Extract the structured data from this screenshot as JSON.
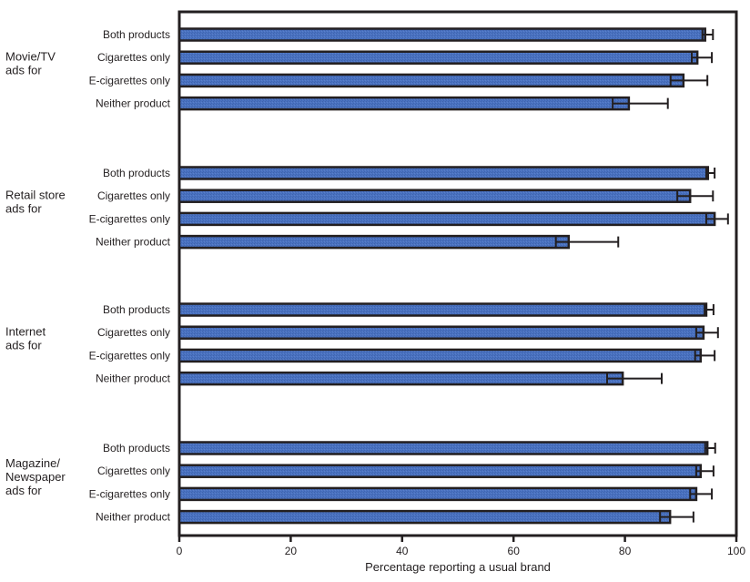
{
  "chart_data": {
    "type": "bar",
    "orientation": "horizontal",
    "title": "",
    "xlabel": "Percentage reporting a usual brand",
    "ylabel": "",
    "xlim": [
      0,
      100
    ],
    "xticks": [
      0,
      20,
      40,
      60,
      80,
      100
    ],
    "grid": false,
    "legend": null,
    "error_bars": "95% confidence interval",
    "colors": {
      "bar_fill": "#4a72c0",
      "bar_edge": "#231f20",
      "frame": "#231f20"
    },
    "categories": [
      "Both products",
      "Cigarettes only",
      "E-cigarettes only",
      "Neither product"
    ],
    "groups": [
      {
        "label_lines": [
          "Movie/TV",
          "ads for"
        ],
        "bars": [
          {
            "category": "Both products",
            "value": 94.4,
            "ci_low": 93.9,
            "ci_high": 95.8
          },
          {
            "category": "Cigarettes only",
            "value": 93.0,
            "ci_low": 92.0,
            "ci_high": 95.6
          },
          {
            "category": "E-cigarettes only",
            "value": 90.5,
            "ci_low": 88.2,
            "ci_high": 94.8
          },
          {
            "category": "Neither product",
            "value": 80.7,
            "ci_low": 77.8,
            "ci_high": 87.7
          }
        ]
      },
      {
        "label_lines": [
          "Retail store",
          "ads for"
        ],
        "bars": [
          {
            "category": "Both products",
            "value": 94.9,
            "ci_low": 94.6,
            "ci_high": 96.1
          },
          {
            "category": "Cigarettes only",
            "value": 91.7,
            "ci_low": 89.4,
            "ci_high": 95.8
          },
          {
            "category": "E-cigarettes only",
            "value": 96.1,
            "ci_low": 94.6,
            "ci_high": 98.5
          },
          {
            "category": "Neither product",
            "value": 69.9,
            "ci_low": 67.6,
            "ci_high": 78.8
          }
        ]
      },
      {
        "label_lines": [
          "Internet",
          "ads for"
        ],
        "bars": [
          {
            "category": "Both products",
            "value": 94.6,
            "ci_low": 94.3,
            "ci_high": 95.9
          },
          {
            "category": "Cigarettes only",
            "value": 94.1,
            "ci_low": 92.8,
            "ci_high": 96.7
          },
          {
            "category": "E-cigarettes only",
            "value": 93.6,
            "ci_low": 92.6,
            "ci_high": 96.1
          },
          {
            "category": "Neither product",
            "value": 79.6,
            "ci_low": 76.8,
            "ci_high": 86.6
          }
        ]
      },
      {
        "label_lines": [
          "Magazine/",
          "Newspaper",
          "ads for"
        ],
        "bars": [
          {
            "category": "Both products",
            "value": 94.8,
            "ci_low": 94.4,
            "ci_high": 96.2
          },
          {
            "category": "Cigarettes only",
            "value": 93.6,
            "ci_low": 92.8,
            "ci_high": 95.9
          },
          {
            "category": "E-cigarettes only",
            "value": 92.8,
            "ci_low": 91.7,
            "ci_high": 95.6
          },
          {
            "category": "Neither product",
            "value": 88.1,
            "ci_low": 86.3,
            "ci_high": 92.3
          }
        ]
      }
    ]
  }
}
